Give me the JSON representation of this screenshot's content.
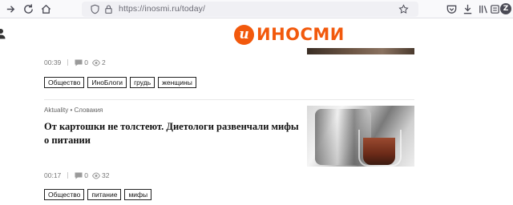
{
  "browser": {
    "url": "https://inosmi.ru/today/",
    "profile_initial": "Z",
    "icons": [
      "forward-icon",
      "reload-icon",
      "home-icon",
      "shield-icon",
      "lock-icon",
      "star-icon",
      "pocket-icon",
      "download-icon",
      "library-icon",
      "reader-icon"
    ]
  },
  "site": {
    "logo_mark": "и",
    "logo_text": "ИНОСМИ",
    "brand_color": "#f2590c"
  },
  "articles": [
    {
      "time": "00:39",
      "comments": "0",
      "views": "2",
      "tags": [
        "Общество",
        "ИноБлоги",
        "грудь",
        "женщины"
      ]
    },
    {
      "rubric": "Aktuality • Словакия",
      "title": "От картошки не толстеют. Диетологи развенчали мифы о питании",
      "time": "00:17",
      "comments": "0",
      "views": "32",
      "tags": [
        "Общество",
        "питание",
        "мифы"
      ]
    }
  ]
}
